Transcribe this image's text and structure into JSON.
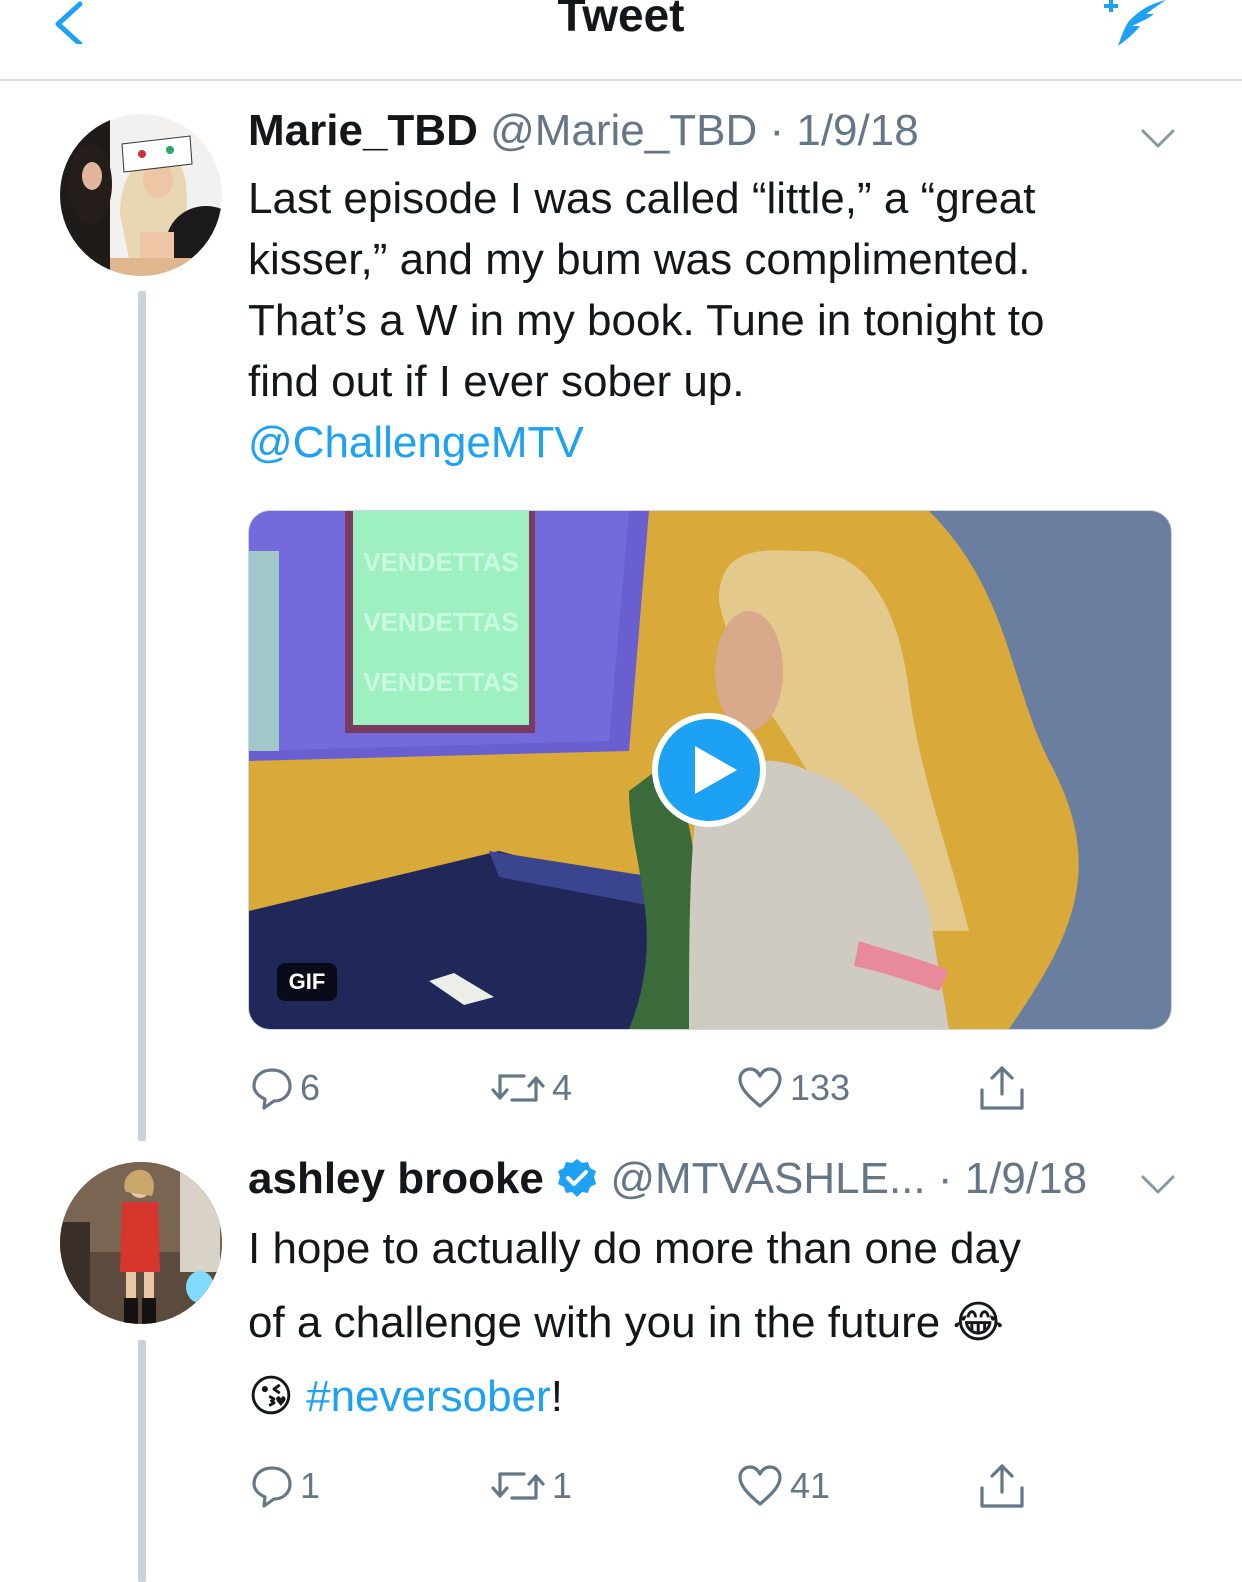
{
  "header": {
    "title": "Tweet",
    "back_icon": "chevron-left-icon",
    "compose_icon": "compose-tweet-icon",
    "accent": "#1da1f2"
  },
  "tweet1": {
    "name": "Marie_TBD",
    "handle": "@Marie_TBD",
    "date": "1/9/18",
    "text_lines": [
      "Last episode I was called “little,” a “great",
      "kisser,” and my bum was complimented.",
      "That’s a W in my book. Tune in tonight to",
      "find out if I ever sober up."
    ],
    "mention": "@ChallengeMTV",
    "media": {
      "badge": "GIF",
      "play_icon": "play-icon",
      "sign_text": "VENDETTAS"
    },
    "actions": {
      "replies": "6",
      "retweets": "4",
      "likes": "133"
    }
  },
  "tweet2": {
    "name": "ashley brooke",
    "verified_icon": "verified-badge-icon",
    "handle": "@MTVASHLE...",
    "date": "1/9/18",
    "text_lines": [
      "I hope to actually do more than one day",
      "of a challenge with you in the future"
    ],
    "emoji_1": "😂",
    "emoji_2": "😘",
    "hashtag": "#neversober",
    "suffix": "!",
    "actions": {
      "replies": "1",
      "retweets": "1",
      "likes": "41"
    }
  }
}
